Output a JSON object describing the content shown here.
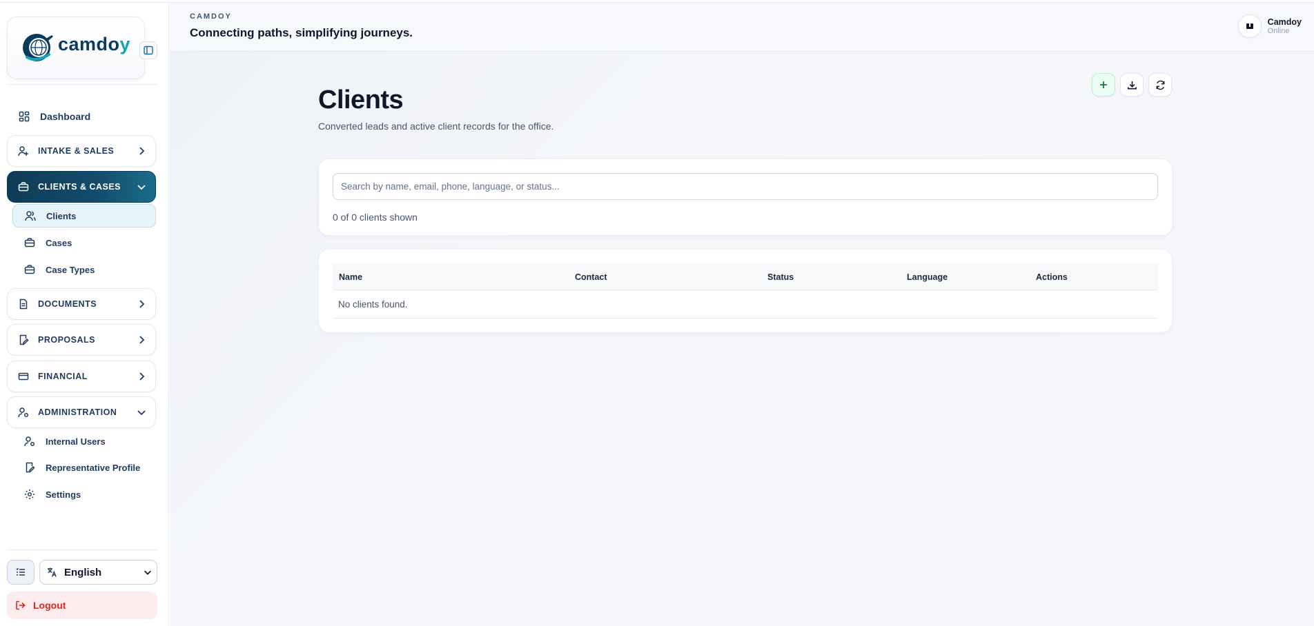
{
  "brand": {
    "logo_text_main": "camdo",
    "logo_text_accent": "y"
  },
  "sidebar": {
    "dashboard": "Dashboard",
    "groups": {
      "intake": "INTAKE & SALES",
      "clients_cases": "CLIENTS & CASES",
      "documents": "DOCUMENTS",
      "proposals": "PROPOSALS",
      "financial": "FINANCIAL",
      "administration": "ADMINISTRATION"
    },
    "clients_cases_items": [
      "Clients",
      "Cases",
      "Case Types"
    ],
    "administration_items": [
      "Internal Users",
      "Representative Profile",
      "Settings"
    ],
    "language": "English",
    "logout": "Logout"
  },
  "header": {
    "brand_small": "CAMDOY",
    "tagline": "Connecting paths, simplifying journeys.",
    "user_name": "Camdoy",
    "user_status": "Online"
  },
  "page": {
    "title": "Clients",
    "subtitle": "Converted leads and active client records for the office."
  },
  "search": {
    "placeholder": "Search by name, email, phone, language, or status...",
    "value": "",
    "count_text": "0 of 0 clients shown"
  },
  "table": {
    "columns": [
      "Name",
      "Contact",
      "Status",
      "Language",
      "Actions"
    ],
    "empty_message": "No clients found."
  },
  "colors": {
    "active_nav": "#134c6b",
    "accent": "#17a2b8",
    "logout": "#dc2626",
    "add_button": "#ecfdf3"
  }
}
